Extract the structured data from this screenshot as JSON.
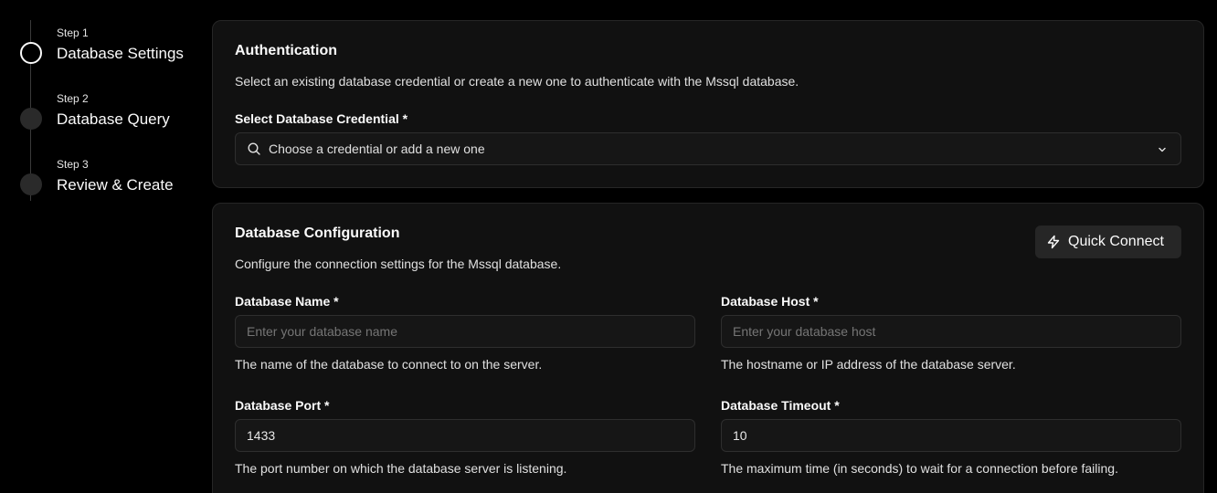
{
  "stepper": {
    "steps": [
      {
        "number": "Step 1",
        "title": "Database Settings",
        "state": "active"
      },
      {
        "number": "Step 2",
        "title": "Database Query",
        "state": "pending"
      },
      {
        "number": "Step 3",
        "title": "Review & Create",
        "state": "pending"
      }
    ]
  },
  "auth": {
    "title": "Authentication",
    "description": "Select an existing database credential or create a new one to authenticate with the Mssql database.",
    "credential_label": "Select Database Credential *",
    "credential_placeholder": "Choose a credential or add a new one"
  },
  "config": {
    "title": "Database Configuration",
    "description": "Configure the connection settings for the Mssql database.",
    "quick_connect_label": "Quick Connect",
    "fields": {
      "name": {
        "label": "Database Name *",
        "placeholder": "Enter your database name",
        "value": "",
        "help": "The name of the database to connect to on the server."
      },
      "host": {
        "label": "Database Host *",
        "placeholder": "Enter your database host",
        "value": "",
        "help": "The hostname or IP address of the database server."
      },
      "port": {
        "label": "Database Port *",
        "placeholder": "",
        "value": "1433",
        "help": "The port number on which the database server is listening."
      },
      "timeout": {
        "label": "Database Timeout *",
        "placeholder": "",
        "value": "10",
        "help": "The maximum time (in seconds) to wait for a connection before failing."
      }
    }
  },
  "colors": {
    "background": "#000000",
    "card": "#111111",
    "border": "#262626",
    "input_bg": "#161616",
    "button_bg": "#262626",
    "text": "#fafafa"
  }
}
